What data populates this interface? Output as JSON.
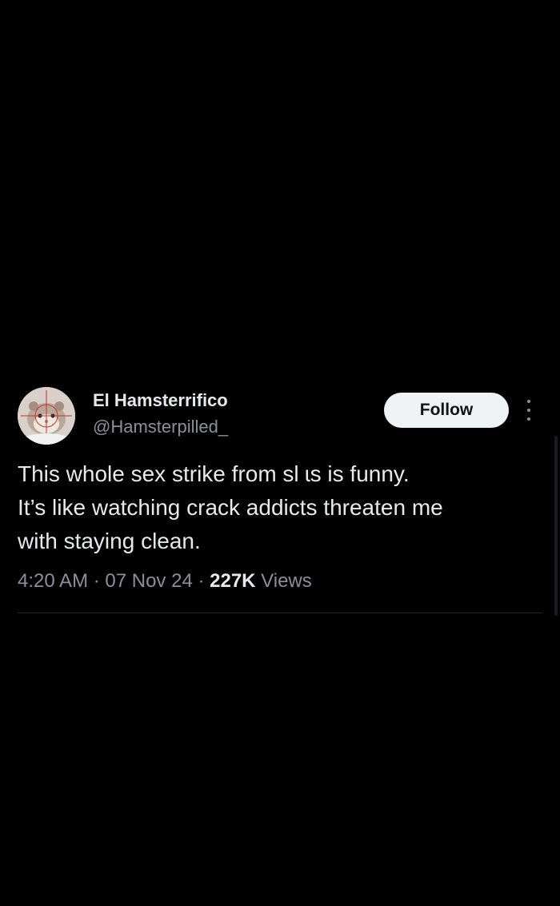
{
  "author": {
    "display_name": "El Hamsterrifico",
    "handle": "@Hamsterpilled_",
    "avatar_icon": "hamster-avatar-icon"
  },
  "actions": {
    "follow_label": "Follow",
    "more_icon": "more-options-icon"
  },
  "tweet": {
    "text": "This whole sex strike from sl   ɩs is funny.\nIt’s like watching crack addicts threaten me\nwith staying clean."
  },
  "meta": {
    "time": "4:20 AM",
    "separator": " · ",
    "date": "07 Nov 24",
    "views_count": "227K",
    "views_label": " Views"
  },
  "colors": {
    "background": "#000000",
    "primary_text": "#e7e9ea",
    "secondary_text": "#8b9096",
    "follow_bg": "#eff3f4",
    "follow_text": "#0f1419"
  }
}
